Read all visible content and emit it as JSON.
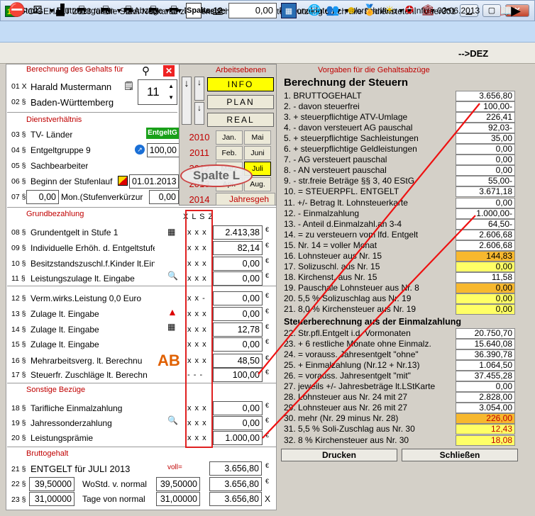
{
  "window": {
    "icon_label": "13",
    "title": "PC-GEHALT 2013 für die Stadt Neckartal zur dienstlichen und privaten Nutzung durch alle Bediensteten.",
    "user": "User001"
  },
  "menu": [
    "Start",
    "Bruttovorgaben",
    "Abzüge",
    "Nachweise drucken",
    "Personaldaten",
    "Vorschriften",
    "Info"
  ],
  "menu_date": "02.06.2013",
  "toolbar": {
    "field_value": "0,00",
    "dez_label": "-->DEZ"
  },
  "left": {
    "heading_calc": "Berechnung des Gehalts für",
    "rows": [
      {
        "num": "01 X",
        "label": "Harald Mustermann"
      },
      {
        "num": "02 §",
        "label": "Baden-Württemberg"
      }
    ],
    "pers_num": "11",
    "sec_dienst": "Dienstverhältnis",
    "dienst_rows": [
      {
        "num": "03 §",
        "label": "TV- Länder"
      },
      {
        "num": "04 §",
        "label": "Entgeltgruppe 9"
      },
      {
        "num": "05 §",
        "label": "Sachbearbeiter"
      },
      {
        "num": "06 §",
        "label": "Beginn der Stufenlauf"
      },
      {
        "num": "07 §",
        "label": "Mon.(Stufenverkürzur"
      }
    ],
    "entgelt_tag": "EntgeltG",
    "dienst_vals": {
      "r04": "100,00",
      "r06": "01.01.2013",
      "r07a": "0,00",
      "r07b": "0,00"
    },
    "sec_grund": "Grundbezahlung",
    "xls_header": "X L S Z",
    "grund_rows": [
      {
        "num": "08 §",
        "label": "Grundentgelt in Stufe 1",
        "xls": "x x x",
        "value": "2.413,38"
      },
      {
        "num": "09 §",
        "label": "Individuelle Erhöh. d. Entgeltstufe",
        "xls": "x x x",
        "value": "82,14"
      },
      {
        "num": "10 §",
        "label": "Besitzstandszuschl.f.Kinder lt.Ein",
        "xls": "x x x",
        "value": "0,00"
      },
      {
        "num": "11 §",
        "label": "Leistungszulage lt. Eingabe",
        "xls": "x x x",
        "value": "0,00"
      },
      {
        "num": "12 §",
        "label": "Verm.wirks.Leistung   0,0 Euro",
        "xls": "x x -",
        "value": "0,00"
      },
      {
        "num": "13 §",
        "label": "Zulage lt. Eingabe",
        "xls": "x x x",
        "value": "0,00"
      },
      {
        "num": "14 §",
        "label": "Zulage lt. Eingabe",
        "xls": "x x x",
        "value": "12,78"
      },
      {
        "num": "15 §",
        "label": "Zulage lt. Eingabe",
        "xls": "x x x",
        "value": "0,00"
      },
      {
        "num": "16 §",
        "label": "Mehrarbeitsverg. lt. Berechnu",
        "xls": "x x x",
        "value": "48,50"
      },
      {
        "num": "17 §",
        "label": "Steuerfr. Zuschläge lt. Berechn",
        "xls": "- - -",
        "value": "100,00"
      }
    ],
    "sec_sonstige": "Sonstige Bezüge",
    "sonst_rows": [
      {
        "num": "18 §",
        "label": "Tarifliche Einmalzahlung",
        "xls": "x x x",
        "value": "0,00"
      },
      {
        "num": "19 §",
        "label": "Jahressonderzahlung",
        "xls": "x x x",
        "value": "0,00"
      },
      {
        "num": "20 §",
        "label": "Leistungsprämie",
        "xls": "x x x",
        "value": "1.000,00"
      }
    ],
    "sec_brutto": "Bruttogehalt",
    "brutto": {
      "r21": "ENTGELT für JULI  2013",
      "r21_tag": "voll=",
      "r21_val": "3.656,80",
      "r22_in": "39,50000",
      "r22_lbl": "WoStd. v. normal",
      "r22_in2": "39,50000",
      "r22_val": "3.656,80",
      "r23_in": "31,00000",
      "r23_lbl": "Tage von normal",
      "r23_in2": "31,00000",
      "r23_val": "3.656,80",
      "r23_x": "X"
    }
  },
  "arbeit": {
    "title": "Arbeitsebenen",
    "buttons": [
      "INFO",
      "PLAN",
      "REAL"
    ],
    "years": [
      "2010",
      "2011",
      "2012",
      "2013",
      "2014"
    ],
    "months": [
      "Jan.",
      "Mai",
      "Feb.",
      "Juni",
      "März",
      "Juli",
      "Apr.",
      "Aug."
    ],
    "jahresgeh": "Jahresgeh"
  },
  "callout": "Spalte L",
  "right": {
    "heading": "Vorgaben für die Gehaltsabzüge",
    "title": "Berechnung der Steuern",
    "rows": [
      {
        "label": "1.  BRUTTOGEHALT",
        "value": "3.656,80"
      },
      {
        "label": "2.   -   davon steuerfrei",
        "value": "100,00-"
      },
      {
        "label": "3.   +   steuerpflichtige ATV-Umlage",
        "value": "226,41"
      },
      {
        "label": "4.   -   davon versteuert AG pauschal",
        "value": "92,03-"
      },
      {
        "label": "5.   +   steuerpflichtige Sachleistungen",
        "value": "35,00"
      },
      {
        "label": "6.   +   steuerpflichtige Geldleistungen",
        "value": "0,00"
      },
      {
        "label": "7.   -   AG versteuert pauschal",
        "value": "0,00"
      },
      {
        "label": "8.   -   AN versteuert pauschal",
        "value": "0,00"
      },
      {
        "label": "9.   -   str.freie Beträge §§ 3, 40 EStG",
        "value": "55,00-"
      },
      {
        "label": "10. = STEUERPFL. ENTGELT",
        "value": "3.671,18"
      },
      {
        "label": "11. +/- Betrag lt. Lohnsteuerkarte",
        "value": "0,00"
      },
      {
        "label": "12.  -  Einmalzahlung",
        "value": "1.000,00-"
      },
      {
        "label": "13.  -  Anteil d.Einmalzahl.an 3-4",
        "value": "64,50-"
      },
      {
        "label": "14.  =  zu versteuern vom lfd. Entgelt",
        "value": "2.606,68"
      },
      {
        "label": "15.  Nr. 14 = voller Monat",
        "value": "2.606,68"
      },
      {
        "label": "16. Lohnsteuer aus Nr. 15",
        "value": "144,83"
      },
      {
        "label": "17. Solizuschl. aus Nr. 15",
        "value": "0,00"
      },
      {
        "label": "18. Kirchenst. aus Nr. 15",
        "value": "11,58"
      },
      {
        "label": "19. Pauschale Lohnsteuer aus Nr. 8",
        "value": "0,00"
      },
      {
        "label": "20.  5,5 % Solizuschlag aus Nr. 19",
        "value": "0,00"
      },
      {
        "label": "21.  8,0 %    Kirchensteuer aus Nr. 19",
        "value": "0,00"
      }
    ],
    "sub_title": "Steuerberechnung aus der Einmalzahlung",
    "rows2": [
      {
        "label": "22. Str.pfl.Entgelt i.d. Vormonaten",
        "value": "20.750,70"
      },
      {
        "label": "23. + 6 restliche Monate ohne Einmalz.",
        "value": "15.640,08"
      },
      {
        "label": "24. = vorauss. Jahresentgelt \"ohne\"",
        "value": "36.390,78"
      },
      {
        "label": "25. + Einmalzahlung (Nr.12 + Nr.13)",
        "value": "1.064,50"
      },
      {
        "label": "26. = vorauss. Jahresentgelt \"mit\"",
        "value": "37.455,28"
      },
      {
        "label": "27. jeweils +/- Jahresbeträge lt.LStKarte",
        "value": "0,00"
      },
      {
        "label": "28. Lohnsteuer aus Nr. 24 mit 27",
        "value": "2.828,00"
      },
      {
        "label": "29. Lohnsteuer aus Nr. 26 mit 27",
        "value": "3.054,00"
      },
      {
        "label": "30. mehr (Nr. 29 minus Nr. 28)",
        "value": "226,00"
      },
      {
        "label": "31. 5,5 % Soli-Zuschlag aus Nr. 30",
        "value": "12,43"
      },
      {
        "label": "32. 8    % Kirchensteuer aus Nr. 30",
        "value": "18,08"
      }
    ],
    "print_label": "Drucken",
    "close_label": "Schließen"
  },
  "colors": {
    "orange": "#f7b82e",
    "yellow": "#ffff66",
    "red_annotation": "#ee1111",
    "section_red": "#c00000"
  }
}
